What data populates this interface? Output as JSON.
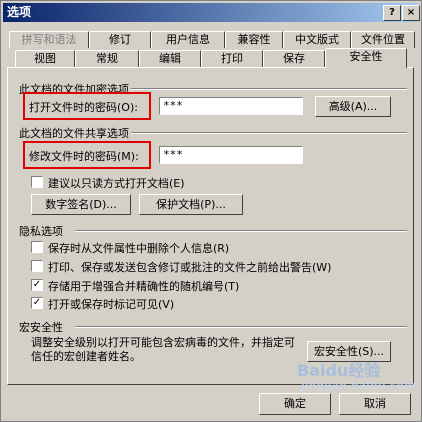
{
  "window": {
    "title": "选项",
    "help_btn": "?",
    "close_btn": "×"
  },
  "tabs_row1": [
    "拼写和语法",
    "修订",
    "用户信息",
    "兼容性",
    "中文版式",
    "文件位置"
  ],
  "tabs_row2": [
    "视图",
    "常规",
    "编辑",
    "打印",
    "保存",
    "安全性"
  ],
  "encryption": {
    "section": "此文档的文件加密选项",
    "open_pw_label": "打开文件时的密码(O):",
    "open_pw_value": "***",
    "advanced_btn": "高级(A)..."
  },
  "sharing": {
    "section": "此文档的文件共享选项",
    "modify_pw_label": "修改文件时的密码(M):",
    "modify_pw_value": "***",
    "readonly_label": "建议以只读方式打开文档(E)",
    "digital_sig_btn": "数字签名(D)...",
    "protect_doc_btn": "保护文档(P)..."
  },
  "privacy": {
    "section": "隐私选项",
    "items": [
      {
        "label": "保存时从文件属性中删除个人信息(R)",
        "checked": false
      },
      {
        "label": "打印、保存或发送包含修订或批注的文件之前给出警告(W)",
        "checked": false
      },
      {
        "label": "存储用于增强合并精确性的随机编号(T)",
        "checked": true
      },
      {
        "label": "打开或保存时标记可见(V)",
        "checked": true
      }
    ]
  },
  "macro": {
    "section": "宏安全性",
    "description": "调整安全级别以打开可能包含宏病毒的文件，并指定可信任的宏创建者姓名。",
    "macro_btn": "宏安全性(S)..."
  },
  "footer": {
    "ok_btn": "确定",
    "cancel_btn": "取消"
  },
  "watermark": {
    "line1": "Baidu经验",
    "line2": "jingyan.baidu.com"
  },
  "check_mark": "✓"
}
